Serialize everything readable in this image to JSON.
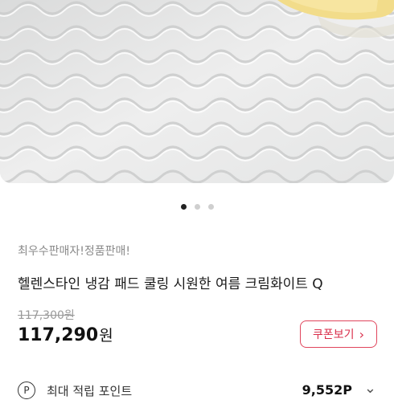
{
  "carousel": {
    "total": 3,
    "active_index": 0
  },
  "product": {
    "seller_badge": "최우수판매자!정품판매!",
    "title": "헬렌스타인 냉감 패드 쿨링 시원한 여름 크림화이트 Q",
    "original_price": "117,300원",
    "sale_price": "117,290",
    "currency": "원"
  },
  "coupon": {
    "label": "쿠폰보기",
    "chevron": "›"
  },
  "points": {
    "icon": "P",
    "label": "최대 적립 포인트",
    "value": "9,552P",
    "chevron": "⌄"
  },
  "colors": {
    "accent": "#e0455c",
    "text": "#111111"
  }
}
